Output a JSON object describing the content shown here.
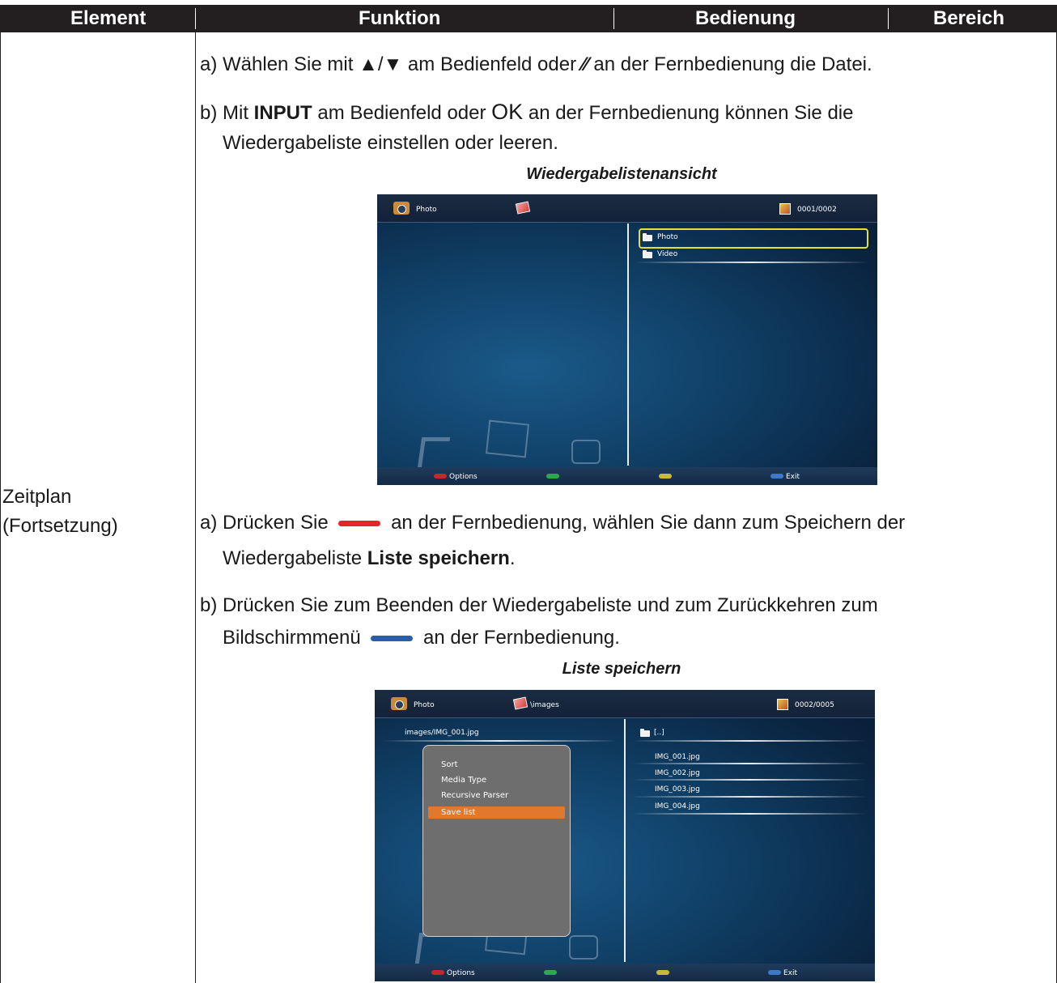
{
  "table": {
    "headers": [
      "Element",
      "Funktion",
      "Bedienung",
      "Bereich"
    ],
    "element": [
      "Zeitplan",
      "(Fortsetzung)"
    ]
  },
  "section1": {
    "line_a_1": "a) Wählen Sie mit ",
    "line_a_sym": "▲/▼",
    "line_a_2": " am Bedienfeld oder ",
    "line_a_sym2": "⁄⁄",
    "line_a_3": " an der Fernbedienung die Datei.",
    "line_b1_1": "b) Mit ",
    "line_b1_bold": "INPUT",
    "line_b1_2": " am Bedienfeld oder ",
    "line_b1_ok": "OK",
    "line_b1_3": " an der Fernbedienung können Sie die",
    "line_b2": "Wiedergabeliste einstellen oder leeren.",
    "caption": "Wiedergabelistenansicht"
  },
  "screen1": {
    "top_label": "Photo",
    "counter": "0001/0002",
    "items": [
      "Photo",
      "Video"
    ],
    "footer": {
      "options": "Options",
      "exit": "Exit"
    }
  },
  "section2": {
    "line_a1_1": "a) Drücken Sie ",
    "line_a1_2": " an der Fernbedienung, wählen Sie dann zum Speichern der",
    "line_a2_1": "Wiedergabeliste ",
    "line_a2_bold": "Liste speichern",
    "line_a2_2": ".",
    "line_b1": "b) Drücken Sie zum Beenden der Wiedergabeliste und zum Zurückkehren zum",
    "line_b2_1": "Bildschirmmenü ",
    "line_b2_2": " an der Fernbedienung.",
    "caption": "Liste speichern"
  },
  "screen2": {
    "top_label": "Photo",
    "path": "\\images",
    "counter": "0002/0005",
    "current_file": "images/IMG_001.jpg",
    "files": [
      "[..]",
      "IMG_001.jpg",
      "IMG_002.jpg",
      "IMG_003.jpg",
      "IMG_004.jpg"
    ],
    "menu": [
      "Sort",
      "Media Type",
      "Recursive Parser",
      "Save list"
    ],
    "footer": {
      "options": "Options",
      "exit": "Exit"
    }
  },
  "colors": {
    "red_key": "#e8232a",
    "green_key": "#2fa84a",
    "yellow_key": "#c9b83a",
    "blue_key": "#2a5ea8",
    "menu_selected": "#e0782e",
    "header_bg": "#231f20"
  }
}
